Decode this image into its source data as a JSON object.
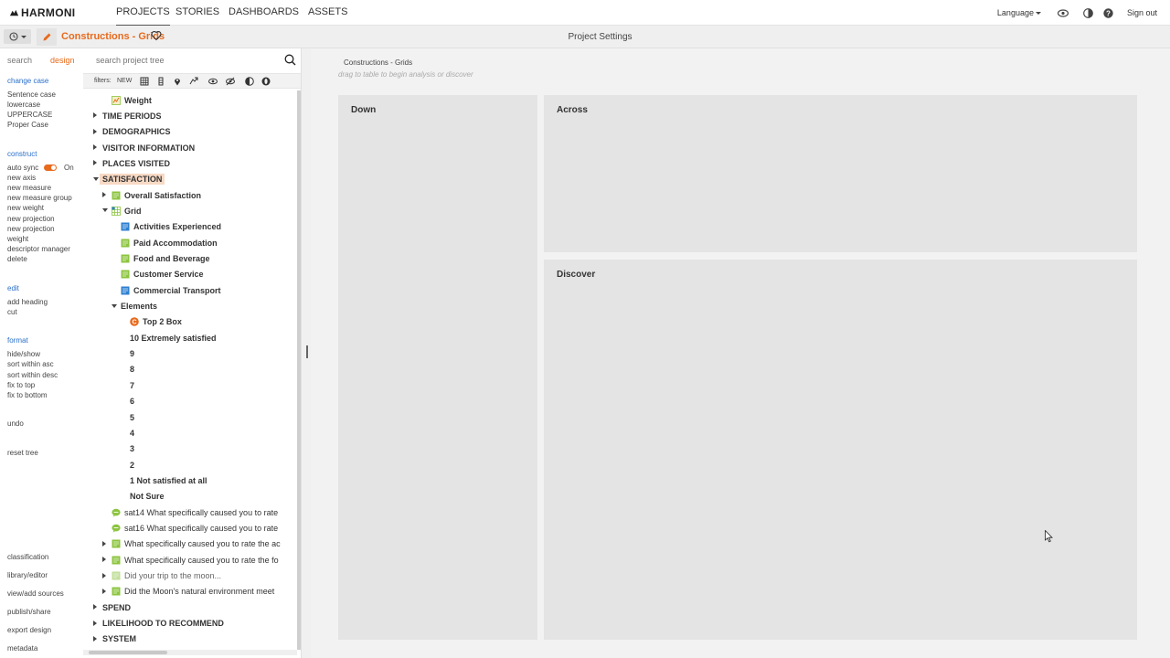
{
  "nav": {
    "logo": "HARMONI",
    "tabs": [
      "PROJECTS",
      "STORIES",
      "DASHBOARDS",
      "ASSETS"
    ],
    "active_tab": "PROJECTS",
    "language": "Language",
    "signout": "Sign out"
  },
  "subbar": {
    "project_title": "Constructions - Grids",
    "settings_title": "Project Settings"
  },
  "left": {
    "mode_search": "search",
    "mode_design": "design",
    "change_case": {
      "heading": "change case",
      "items": [
        "Sentence case",
        "lowercase",
        "UPPERCASE",
        "Proper Case"
      ]
    },
    "construct": {
      "heading": "construct",
      "autosync_label": "auto sync",
      "autosync_state": "On",
      "items": [
        "new axis",
        "new measure",
        "new measure group",
        "new weight",
        "new projection",
        "new projection",
        "weight",
        "descriptor manager",
        "delete"
      ]
    },
    "edit": {
      "heading": "edit",
      "items": [
        "add heading",
        "cut"
      ]
    },
    "format": {
      "heading": "format",
      "items": [
        "hide/show",
        "sort within asc",
        "sort within desc",
        "fix to top",
        "fix to bottom"
      ]
    },
    "undo": "undo",
    "reset_tree": "reset tree",
    "bottom_items": [
      "classification",
      "library/editor",
      "view/add sources",
      "publish/share",
      "export design",
      "metadata"
    ]
  },
  "tree": {
    "search_placeholder": "search project tree",
    "filters_label": "filters:",
    "filters_new": "NEW",
    "rows": [
      {
        "label": "Weight",
        "indent": 1,
        "icon": "weight-icon",
        "caret": "none",
        "style": "bold"
      },
      {
        "label": "TIME PERIODS",
        "indent": 0,
        "icon": "",
        "caret": "right",
        "style": "cat"
      },
      {
        "label": "DEMOGRAPHICS",
        "indent": 0,
        "icon": "",
        "caret": "right",
        "style": "cat"
      },
      {
        "label": "VISITOR INFORMATION",
        "indent": 0,
        "icon": "",
        "caret": "right",
        "style": "cat"
      },
      {
        "label": "PLACES VISITED",
        "indent": 0,
        "icon": "",
        "caret": "right",
        "style": "cat"
      },
      {
        "label": "SATISFACTION",
        "indent": 0,
        "icon": "",
        "caret": "down",
        "style": "cat highlight"
      },
      {
        "label": "Overall Satisfaction",
        "indent": 1,
        "icon": "green-measure-icon",
        "caret": "right",
        "style": "bold"
      },
      {
        "label": "Grid",
        "indent": 1,
        "icon": "grid-icon",
        "caret": "down",
        "style": "bold"
      },
      {
        "label": "Activities Experienced",
        "indent": 2,
        "icon": "blue-measure-icon",
        "caret": "none",
        "style": "bold"
      },
      {
        "label": "Paid Accommodation",
        "indent": 2,
        "icon": "green-measure-icon",
        "caret": "none",
        "style": "bold"
      },
      {
        "label": "Food and Beverage",
        "indent": 2,
        "icon": "green-measure-icon",
        "caret": "none",
        "style": "bold"
      },
      {
        "label": "Customer Service",
        "indent": 2,
        "icon": "green-measure-icon",
        "caret": "none",
        "style": "bold"
      },
      {
        "label": "Commercial Transport",
        "indent": 2,
        "icon": "blue-measure-icon",
        "caret": "none",
        "style": "bold"
      },
      {
        "label": "Elements",
        "indent": 2,
        "icon": "",
        "caret": "down",
        "style": "bold"
      },
      {
        "label": "Top 2 Box",
        "indent": 3,
        "icon": "construct-c-icon",
        "caret": "none",
        "style": "bold"
      },
      {
        "label": "10 Extremely satisfied",
        "indent": 3,
        "icon": "",
        "caret": "none",
        "style": "bold"
      },
      {
        "label": "9",
        "indent": 3,
        "icon": "",
        "caret": "none",
        "style": "bold"
      },
      {
        "label": "8",
        "indent": 3,
        "icon": "",
        "caret": "none",
        "style": "bold"
      },
      {
        "label": "7",
        "indent": 3,
        "icon": "",
        "caret": "none",
        "style": "bold"
      },
      {
        "label": "6",
        "indent": 3,
        "icon": "",
        "caret": "none",
        "style": "bold"
      },
      {
        "label": "5",
        "indent": 3,
        "icon": "",
        "caret": "none",
        "style": "bold"
      },
      {
        "label": "4",
        "indent": 3,
        "icon": "",
        "caret": "none",
        "style": "bold"
      },
      {
        "label": "3",
        "indent": 3,
        "icon": "",
        "caret": "none",
        "style": "bold"
      },
      {
        "label": "2",
        "indent": 3,
        "icon": "",
        "caret": "none",
        "style": "bold"
      },
      {
        "label": "1 Not satisfied at all",
        "indent": 3,
        "icon": "",
        "caret": "none",
        "style": "bold"
      },
      {
        "label": "Not Sure",
        "indent": 3,
        "icon": "",
        "caret": "none",
        "style": "bold"
      },
      {
        "label": "sat14 What specifically caused you to rate",
        "indent": 1,
        "icon": "open-text-icon",
        "caret": "none",
        "style": "normal"
      },
      {
        "label": "sat16 What specifically caused you to rate",
        "indent": 1,
        "icon": "open-text-icon",
        "caret": "none",
        "style": "normal"
      },
      {
        "label": "What specifically caused you to rate the ac",
        "indent": 1,
        "icon": "green-measure-icon",
        "caret": "right",
        "style": "normal"
      },
      {
        "label": "What specifically caused you to rate the fo",
        "indent": 1,
        "icon": "green-measure-icon",
        "caret": "right",
        "style": "normal"
      },
      {
        "label": "Did your trip to the moon...",
        "indent": 1,
        "icon": "pale-measure-icon",
        "caret": "right",
        "style": "muted"
      },
      {
        "label": "Did the Moon's natural environment meet",
        "indent": 1,
        "icon": "green-measure-icon",
        "caret": "right",
        "style": "normal"
      },
      {
        "label": "SPEND",
        "indent": 0,
        "icon": "",
        "caret": "right",
        "style": "cat"
      },
      {
        "label": "LIKELIHOOD TO RECOMMEND",
        "indent": 0,
        "icon": "",
        "caret": "right",
        "style": "cat"
      },
      {
        "label": "SYSTEM",
        "indent": 0,
        "icon": "",
        "caret": "right",
        "style": "cat"
      }
    ]
  },
  "main": {
    "breadcrumb": "Constructions - Grids",
    "hint": "drag to table to begin analysis or discover",
    "down_label": "Down",
    "across_label": "Across",
    "discover_label": "Discover"
  },
  "colors": {
    "accent": "#e86a1c",
    "link": "#2a6fc9",
    "measure_green": "#8cc43f",
    "measure_blue": "#2f7fd0"
  }
}
